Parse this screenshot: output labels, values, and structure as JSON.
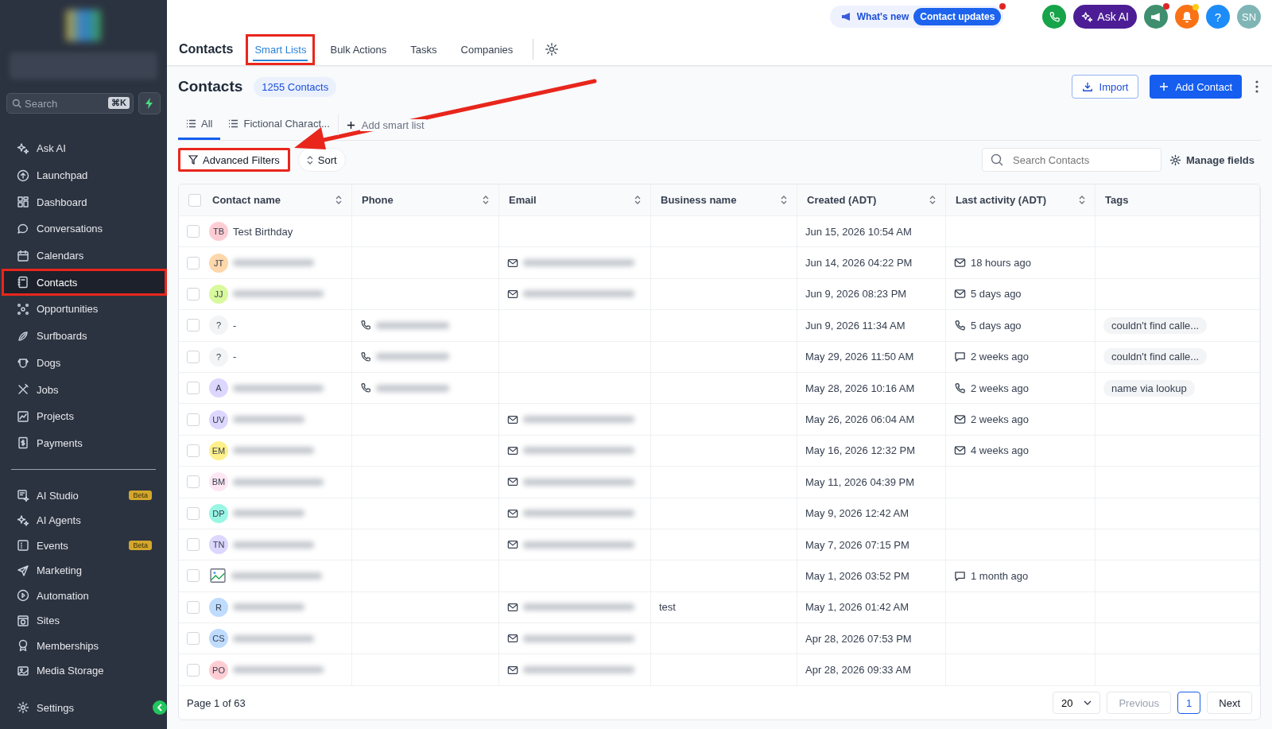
{
  "sidebar": {
    "search": {
      "placeholder": "Search",
      "shortcut": "⌘K"
    },
    "items": [
      {
        "label": "Ask AI",
        "selected": false,
        "highlighted": false
      },
      {
        "label": "Launchpad",
        "selected": false,
        "highlighted": false
      },
      {
        "label": "Dashboard",
        "selected": false,
        "highlighted": false
      },
      {
        "label": "Conversations",
        "selected": false,
        "highlighted": false
      },
      {
        "label": "Calendars",
        "selected": false,
        "highlighted": false
      },
      {
        "label": "Contacts",
        "selected": true,
        "highlighted": true
      },
      {
        "label": "Opportunities",
        "selected": false,
        "highlighted": false
      },
      {
        "label": "Surfboards",
        "selected": false,
        "highlighted": false
      },
      {
        "label": "Dogs",
        "selected": false,
        "highlighted": false
      },
      {
        "label": "Jobs",
        "selected": false,
        "highlighted": false
      },
      {
        "label": "Projects",
        "selected": false,
        "highlighted": false
      },
      {
        "label": "Payments",
        "selected": false,
        "highlighted": false
      }
    ],
    "items_2": [
      {
        "label": "AI Studio",
        "badge": "Beta",
        "selected": false
      },
      {
        "label": "AI Agents",
        "selected": false
      },
      {
        "label": "Events",
        "badge": "Beta",
        "selected": false
      },
      {
        "label": "Marketing",
        "selected": false
      },
      {
        "label": "Automation",
        "selected": false
      },
      {
        "label": "Sites",
        "selected": false
      },
      {
        "label": "Memberships",
        "selected": false
      },
      {
        "label": "Media Storage",
        "selected": false
      }
    ],
    "settings": "Settings"
  },
  "topbar": {
    "title": "Contacts",
    "tabs": [
      {
        "label": "Smart Lists",
        "selected": true,
        "highlighted": true
      },
      {
        "label": "Bulk Actions",
        "selected": false,
        "highlighted": false
      },
      {
        "label": "Tasks",
        "selected": false,
        "highlighted": false
      },
      {
        "label": "Companies",
        "selected": false,
        "highlighted": false
      }
    ],
    "whats_new": "What's new",
    "updates": "Contact updates",
    "ask_ai": "Ask AI",
    "help": "?",
    "avatar": "SN"
  },
  "header": {
    "title": "Contacts",
    "count": "1255 Contacts",
    "import": "Import",
    "add": "Add Contact"
  },
  "smart_lists": [
    {
      "label": "All",
      "selected": true
    },
    {
      "label": "Fictional Charact...",
      "selected": false
    }
  ],
  "add_smart_list": "Add smart list",
  "filters": {
    "advanced": "Advanced Filters",
    "advanced_highlighted": true,
    "sort": "Sort",
    "search_placeholder": "Search Contacts",
    "manage": "Manage fields"
  },
  "table": {
    "all_checked": false,
    "columns": [
      {
        "label": "Contact name",
        "sortable": true
      },
      {
        "label": "Phone",
        "sortable": true
      },
      {
        "label": "Email",
        "sortable": true
      },
      {
        "label": "Business name",
        "sortable": true
      },
      {
        "label": "Created (ADT)",
        "sortable": true
      },
      {
        "label": "Last activity (ADT)",
        "sortable": true
      },
      {
        "label": "Tags",
        "sortable": false
      }
    ],
    "rows": [
      {
        "checked": false,
        "kind": "initials",
        "initials": "TB",
        "color": "#fecdd3",
        "name": "Test Birthday",
        "name_blurred": false,
        "phone_blurred": false,
        "email_blurred": false,
        "created": "Jun 15, 2026 10:54 AM"
      },
      {
        "checked": false,
        "kind": "initials",
        "initials": "JT",
        "color": "#fed7aa",
        "name_blurred": true,
        "phone_blurred": false,
        "email_blurred": true,
        "created": "Jun 14, 2026 04:22 PM",
        "activity": {
          "kind": "email",
          "text": "18 hours ago"
        }
      },
      {
        "checked": false,
        "kind": "initials",
        "initials": "JJ",
        "color": "#d9f99d",
        "name_blurred": true,
        "phone_blurred": false,
        "email_blurred": true,
        "created": "Jun 9, 2026 08:23 PM",
        "activity": {
          "kind": "email",
          "text": "5 days ago"
        }
      },
      {
        "checked": false,
        "kind": "initials",
        "initials": "?",
        "color": "#f3f4f6",
        "name": "-",
        "name_blurred": false,
        "phone_blurred": true,
        "email_blurred": false,
        "created": "Jun 9, 2026 11:34 AM",
        "activity": {
          "kind": "call",
          "text": "5 days ago"
        },
        "tag": "couldn't find calle..."
      },
      {
        "checked": false,
        "kind": "initials",
        "initials": "?",
        "color": "#f3f4f6",
        "name": "-",
        "name_blurred": false,
        "phone_blurred": true,
        "email_blurred": false,
        "created": "May 29, 2026 11:50 AM",
        "activity": {
          "kind": "message",
          "text": "2 weeks ago"
        },
        "tag": "couldn't find calle..."
      },
      {
        "checked": false,
        "kind": "initials",
        "initials": "A",
        "color": "#ddd6fe",
        "name_blurred": true,
        "phone_blurred": true,
        "email_blurred": false,
        "created": "May 28, 2026 10:16 AM",
        "activity": {
          "kind": "call",
          "text": "2 weeks ago"
        },
        "tag": "name via lookup"
      },
      {
        "checked": false,
        "kind": "initials",
        "initials": "UV",
        "color": "#ddd6fe",
        "name_blurred": true,
        "phone_blurred": false,
        "email_blurred": true,
        "created": "May 26, 2026 06:04 AM",
        "activity": {
          "kind": "email",
          "text": "2 weeks ago"
        }
      },
      {
        "checked": false,
        "kind": "initials",
        "initials": "EM",
        "color": "#fef08a",
        "name_blurred": true,
        "phone_blurred": false,
        "email_blurred": true,
        "created": "May 16, 2026 12:32 PM",
        "activity": {
          "kind": "email",
          "text": "4 weeks ago"
        }
      },
      {
        "checked": false,
        "kind": "initials",
        "initials": "BM",
        "color": "#fce7f3",
        "name_blurred": true,
        "phone_blurred": false,
        "email_blurred": true,
        "created": "May 11, 2026 04:39 PM"
      },
      {
        "checked": false,
        "kind": "initials",
        "initials": "DP",
        "color": "#99f6e4",
        "name_blurred": true,
        "phone_blurred": false,
        "email_blurred": true,
        "created": "May 9, 2026 12:42 AM"
      },
      {
        "checked": false,
        "kind": "initials",
        "initials": "TN",
        "color": "#ddd6fe",
        "name_blurred": true,
        "phone_blurred": false,
        "email_blurred": true,
        "created": "May 7, 2026 07:15 PM"
      },
      {
        "checked": false,
        "kind": "image",
        "name_blurred": true,
        "phone_blurred": false,
        "email_blurred": false,
        "created": "May 1, 2026 03:52 PM",
        "activity": {
          "kind": "message",
          "text": "1 month ago"
        }
      },
      {
        "checked": false,
        "kind": "initials",
        "initials": "R",
        "color": "#bfdbfe",
        "name_blurred": true,
        "phone_blurred": false,
        "email_blurred": true,
        "business": "test",
        "created": "May 1, 2026 01:42 AM"
      },
      {
        "checked": false,
        "kind": "initials",
        "initials": "CS",
        "color": "#bfdbfe",
        "name_blurred": true,
        "phone_blurred": false,
        "email_blurred": true,
        "created": "Apr 28, 2026 07:53 PM"
      },
      {
        "checked": false,
        "kind": "initials",
        "initials": "PO",
        "color": "#fecdd3",
        "name_blurred": true,
        "phone_blurred": false,
        "email_blurred": true,
        "created": "Apr 28, 2026 09:33 AM"
      }
    ]
  },
  "pagination": {
    "summary": "Page 1 of 63",
    "page_size": "20",
    "previous": "Previous",
    "previous_disabled": true,
    "pages": [
      {
        "label": "1",
        "selected": true
      }
    ],
    "next": "Next"
  }
}
